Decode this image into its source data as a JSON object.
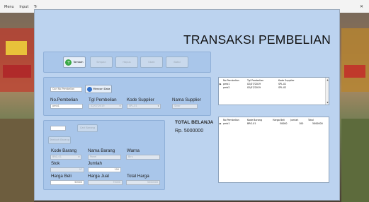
{
  "menu": {
    "items": [
      "Menu",
      "Input",
      "Tr"
    ]
  },
  "title": "TRANSAKSI PEMBELIAN",
  "toolbar": {
    "tambah": "Tambah",
    "simpan": "Simpan",
    "hapus": "Hapus",
    "ubah": "Ubah",
    "batal": "Batal"
  },
  "pembelian": {
    "search_value": "Cari No Pembelian",
    "cari_button": "Mencari Data",
    "no_label": "No.Pembelian",
    "no_value": "pmb1",
    "tgl_label": "Tgl Pembelian",
    "tgl_value": "02/07/2019",
    "kode_supplier_label": "Kode Supplier",
    "kode_supplier_value": "SPL-01",
    "nama_supplier_label": "Nama Supplier",
    "nama_supplier_value": "Sinar"
  },
  "pembelian_grid": {
    "columns": [
      "No Pembelian",
      "Tgl Pembelian",
      "Kode Supplier"
    ],
    "rows": [
      [
        "pmb1",
        "02/07/2019",
        "SPL-01"
      ],
      [
        "pmb2",
        "02/07/2019",
        "SPL-02"
      ]
    ]
  },
  "barang": {
    "cari_barang": "Cari Barang",
    "tambah_barang": "Tambah Barang",
    "kode_label": "Kode Barang",
    "kode_value": "BRG-01",
    "nama_label": "Nama Barang",
    "nama_value": "Panel",
    "warna_label": "Warna",
    "warna_value": "Biru",
    "stok_label": "Stok",
    "stok_value": "97",
    "jumlah_label": "Jumlah",
    "jumlah_value": "100",
    "harga_beli_label": "Harga Beli",
    "harga_beli_value": "50000",
    "harga_jual_label": "Harga Jual",
    "harga_jual_value": "75000",
    "total_harga_label": "Total Harga",
    "total_harga_value": "5000000"
  },
  "total": {
    "label": "TOTAL BELANJA",
    "value": "Rp. 5000000"
  },
  "detail_grid": {
    "columns": [
      "No Pembelian",
      "Kode Barang",
      "Harga Beli",
      "Jumlah",
      "Total"
    ],
    "rows": [
      [
        "pmb1",
        "BRG-01",
        "50000",
        "100",
        "5000000"
      ]
    ]
  },
  "colors": {
    "form_bg": "#bcd3ef",
    "panel_bg": "#a9c6ea",
    "tambah_icon": "#3aa845",
    "cari_icon": "#2f6fc9"
  }
}
